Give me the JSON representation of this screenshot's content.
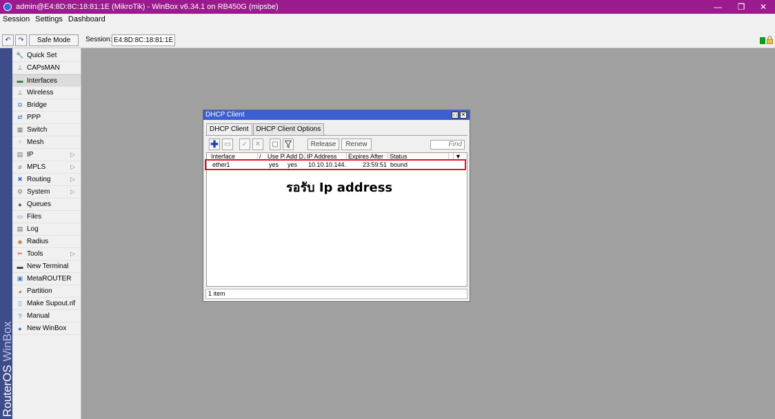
{
  "window": {
    "title": "admin@E4:8D:8C:18:81:1E (MikroTik) - WinBox v6.34.1 on RB450G (mipsbe)",
    "min": "—",
    "max": "❐",
    "close": "✕"
  },
  "menu": [
    "Session",
    "Settings",
    "Dashboard"
  ],
  "toolbar": {
    "undo": "↶",
    "redo": "↷",
    "safe_mode": "Safe Mode",
    "session_label": "Session:",
    "session_value": "E4:8D:8C:18:81:1E"
  },
  "brand": {
    "routeros": "RouterOS",
    "winbox": "WinBox"
  },
  "sidebar": [
    {
      "label": "Quick Set",
      "icon": "quickset-icon",
      "arrow": false
    },
    {
      "label": "CAPsMAN",
      "icon": "antenna-icon",
      "arrow": false
    },
    {
      "label": "Interfaces",
      "icon": "interfaces-icon",
      "arrow": false,
      "active": true
    },
    {
      "label": "Wireless",
      "icon": "wireless-icon",
      "arrow": false
    },
    {
      "label": "Bridge",
      "icon": "bridge-icon",
      "arrow": false
    },
    {
      "label": "PPP",
      "icon": "ppp-icon",
      "arrow": false
    },
    {
      "label": "Switch",
      "icon": "switch-icon",
      "arrow": false
    },
    {
      "label": "Mesh",
      "icon": "mesh-icon",
      "arrow": false
    },
    {
      "label": "IP",
      "icon": "ip-icon",
      "arrow": true
    },
    {
      "label": "MPLS",
      "icon": "mpls-icon",
      "arrow": true
    },
    {
      "label": "Routing",
      "icon": "routing-icon",
      "arrow": true
    },
    {
      "label": "System",
      "icon": "system-icon",
      "arrow": true
    },
    {
      "label": "Queues",
      "icon": "queues-icon",
      "arrow": false
    },
    {
      "label": "Files",
      "icon": "files-icon",
      "arrow": false
    },
    {
      "label": "Log",
      "icon": "log-icon",
      "arrow": false
    },
    {
      "label": "Radius",
      "icon": "radius-icon",
      "arrow": false
    },
    {
      "label": "Tools",
      "icon": "tools-icon",
      "arrow": true
    },
    {
      "label": "New Terminal",
      "icon": "terminal-icon",
      "arrow": false
    },
    {
      "label": "MetaROUTER",
      "icon": "metarouter-icon",
      "arrow": false
    },
    {
      "label": "Partition",
      "icon": "partition-icon",
      "arrow": false
    },
    {
      "label": "Make Supout.rif",
      "icon": "supout-icon",
      "arrow": false
    },
    {
      "label": "Manual",
      "icon": "manual-icon",
      "arrow": false
    },
    {
      "label": "New WinBox",
      "icon": "winbox-icon",
      "arrow": false
    }
  ],
  "sidebar_arrow": "▷",
  "dhcp": {
    "title": "DHCP Client",
    "tabs": [
      "DHCP Client",
      "DHCP Client Options"
    ],
    "buttons": {
      "add": "✚",
      "remove": "▭",
      "enable": "✓",
      "disable": "✕",
      "comment": "▢",
      "filter": "▼",
      "release": "Release",
      "renew": "Renew"
    },
    "find_placeholder": "Find",
    "columns": [
      "Interface",
      "/",
      "Use P...",
      "Add D...",
      "IP Address",
      "Expires After",
      "Status",
      "▼"
    ],
    "rows": [
      {
        "interface": "ether1",
        "use_peer": "yes",
        "add_default": "yes",
        "ip": "10.10.10.144...",
        "expires": "23:59:51",
        "status": "bound"
      }
    ],
    "status_text": "1 item"
  },
  "annotation": "รอรับ Ip address",
  "colors": {
    "titlebar": "#9b1b8e",
    "sidebar_strip": "#3e4c8a",
    "highlight": "#e0141c",
    "window_title": "#3a5fd0"
  }
}
